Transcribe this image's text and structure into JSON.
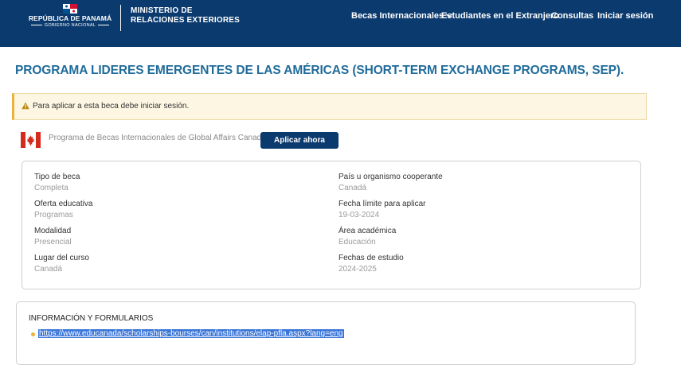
{
  "header": {
    "brand_main": "REPÚBLICA DE PANAMÁ",
    "brand_sub": "GOBIERNO NACIONAL",
    "ministry_line1": "MINISTERIO DE",
    "ministry_line2": "RELACIONES EXTERIORES",
    "nav": [
      {
        "label": "Becas Internacionales"
      },
      {
        "label": "Estudiantes en el Extranjero"
      },
      {
        "label": "Consultas"
      },
      {
        "label": "Iniciar sesión"
      }
    ]
  },
  "page": {
    "title": "PROGRAMA LIDERES EMERGENTES DE LAS AMÉRICAS (SHORT-TERM EXCHANGE PROGRAMS, SEP).",
    "alert": "Para aplicar a esta beca debe iniciar sesión.",
    "program_name": "Programa de Becas Internacionales de Global Affairs Canada",
    "apply_label": "Aplicar ahora"
  },
  "details": {
    "left": [
      {
        "label": "Tipo de beca",
        "value": "Completa"
      },
      {
        "label": "Oferta educativa",
        "value": "Programas"
      },
      {
        "label": "Modalidad",
        "value": "Presencial"
      },
      {
        "label": "Lugar del curso",
        "value": "Canadá"
      }
    ],
    "right": [
      {
        "label": "País u organismo cooperante",
        "value": "Canadá"
      },
      {
        "label": "Fecha límite para aplicar",
        "value": "19-03-2024"
      },
      {
        "label": "Área académica",
        "value": "Educación"
      },
      {
        "label": "Fechas de estudio",
        "value": "2024-2025"
      }
    ]
  },
  "forms": {
    "title": "INFORMACIÓN Y FORMULARIOS",
    "link": "https://www.educanada/scholarships-bourses/can/institutions/elap-pfla.aspx?lang=eng"
  },
  "colors": {
    "header_bg": "#0b3a6e",
    "title": "#1f6b9a",
    "alert_accent": "#e9b43c",
    "link_highlight": "#3a76d8"
  }
}
